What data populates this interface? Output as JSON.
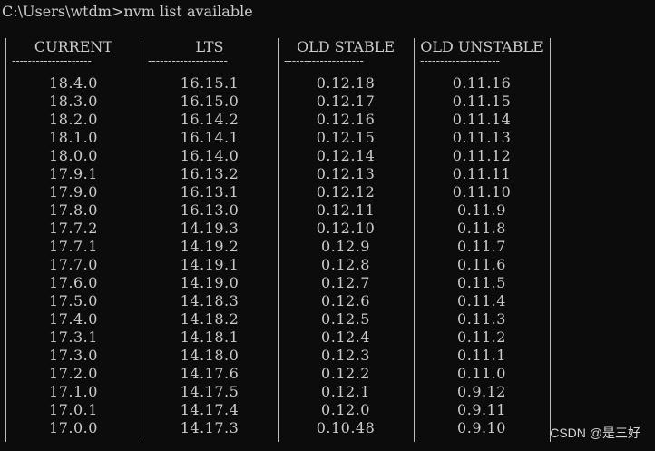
{
  "terminal": {
    "prompt": "C:\\Users\\wtdm>nvm list available"
  },
  "table": {
    "columns": [
      {
        "header": "CURRENT",
        "values": [
          "18.4.0",
          "18.3.0",
          "18.2.0",
          "18.1.0",
          "18.0.0",
          "17.9.1",
          "17.9.0",
          "17.8.0",
          "17.7.2",
          "17.7.1",
          "17.7.0",
          "17.6.0",
          "17.5.0",
          "17.4.0",
          "17.3.1",
          "17.3.0",
          "17.2.0",
          "17.1.0",
          "17.0.1",
          "17.0.0"
        ]
      },
      {
        "header": "LTS",
        "values": [
          "16.15.1",
          "16.15.0",
          "16.14.2",
          "16.14.1",
          "16.14.0",
          "16.13.2",
          "16.13.1",
          "16.13.0",
          "14.19.3",
          "14.19.2",
          "14.19.1",
          "14.19.0",
          "14.18.3",
          "14.18.2",
          "14.18.1",
          "14.18.0",
          "14.17.6",
          "14.17.5",
          "14.17.4",
          "14.17.3"
        ]
      },
      {
        "header": "OLD STABLE",
        "values": [
          "0.12.18",
          "0.12.17",
          "0.12.16",
          "0.12.15",
          "0.12.14",
          "0.12.13",
          "0.12.12",
          "0.12.11",
          "0.12.10",
          "0.12.9",
          "0.12.8",
          "0.12.7",
          "0.12.6",
          "0.12.5",
          "0.12.4",
          "0.12.3",
          "0.12.2",
          "0.12.1",
          "0.12.0",
          "0.10.48"
        ]
      },
      {
        "header": "OLD UNSTABLE",
        "values": [
          "0.11.16",
          "0.11.15",
          "0.11.14",
          "0.11.13",
          "0.11.12",
          "0.11.11",
          "0.11.10",
          "0.11.9",
          "0.11.8",
          "0.11.7",
          "0.11.6",
          "0.11.5",
          "0.11.4",
          "0.11.3",
          "0.11.2",
          "0.11.1",
          "0.11.0",
          "0.9.12",
          "0.9.11",
          "0.9.10"
        ]
      }
    ],
    "separator": "--------------------"
  },
  "watermark": "CSDN @是三好",
  "colors": {
    "background": "#0c0c0c",
    "text": "#cccccc",
    "rule": "#bdbdbd"
  }
}
